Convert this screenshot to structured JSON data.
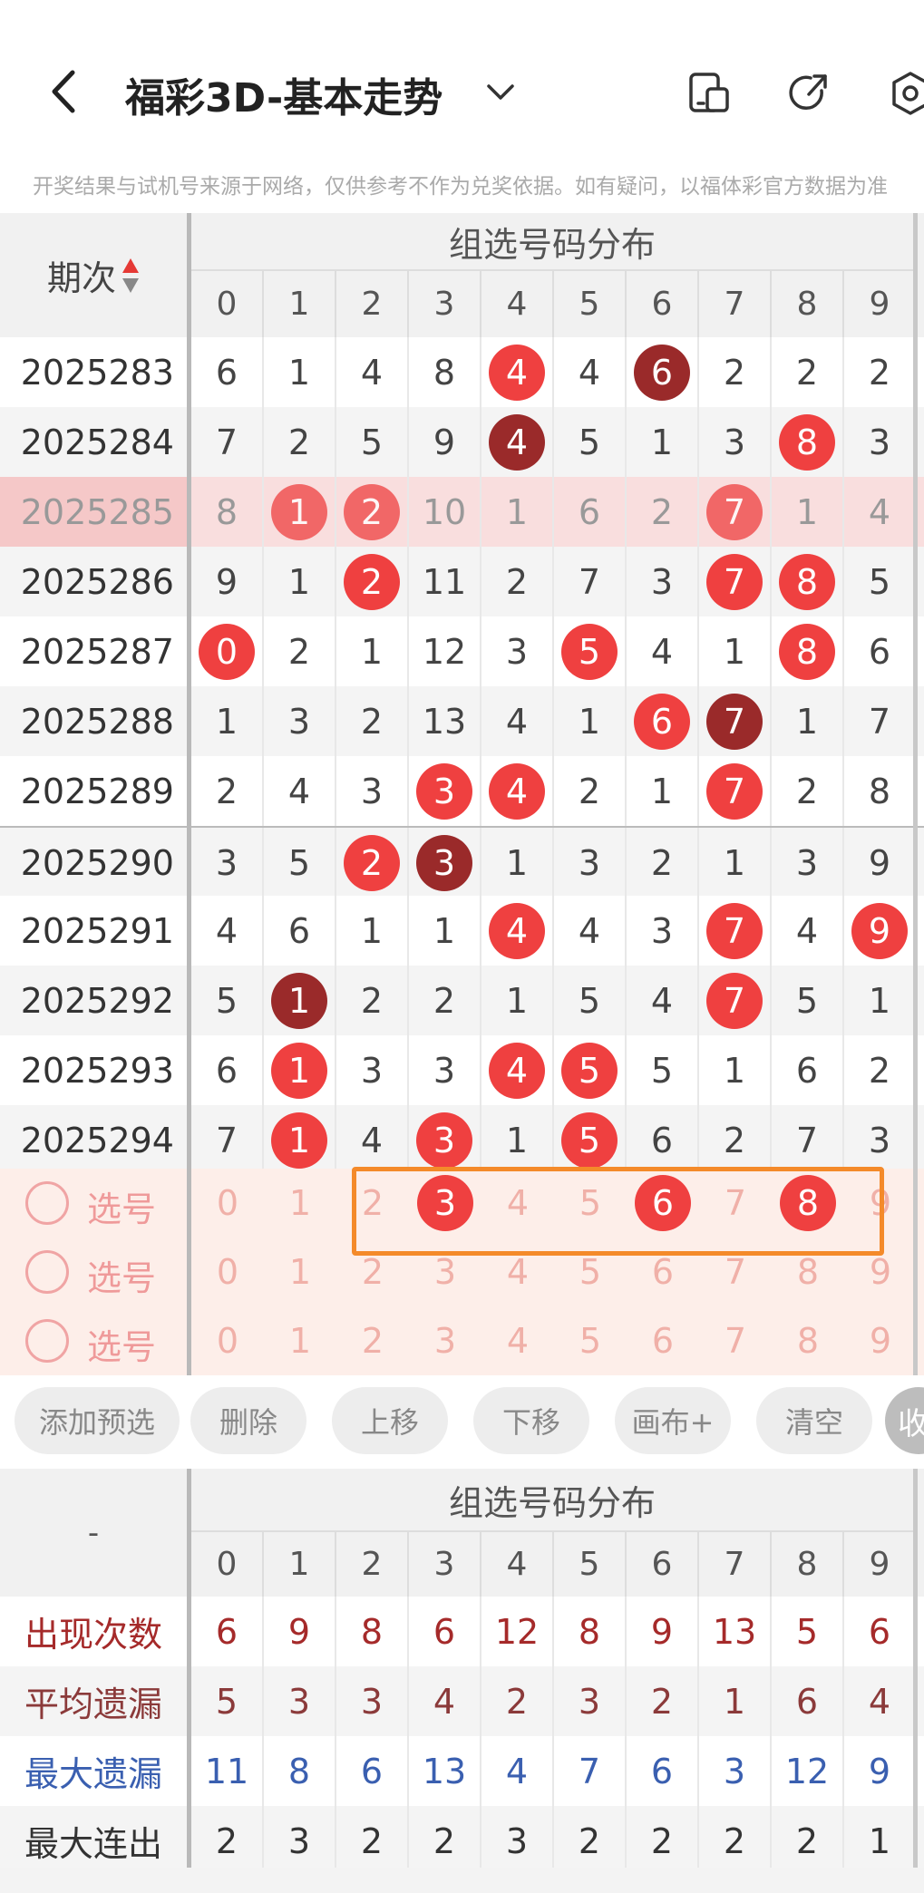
{
  "header": {
    "title": "福彩3D-基本走势"
  },
  "disclaimer": "开奖结果与试机号来源于网络，仅供参考不作为兑奖依据。如有疑问，以福体彩官方数据为准",
  "table": {
    "period_header": "期次",
    "group_header": "组选号码分布",
    "digits": [
      "0",
      "1",
      "2",
      "3",
      "4",
      "5",
      "6",
      "7",
      "8",
      "9"
    ],
    "rows": [
      {
        "period": "2025283",
        "values": [
          "6",
          "1",
          "4",
          "8",
          "4",
          "4",
          "6",
          "2",
          "2",
          "2"
        ],
        "balls": [
          null,
          null,
          null,
          null,
          "red",
          null,
          "dark",
          null,
          null,
          null
        ]
      },
      {
        "period": "2025284",
        "values": [
          "7",
          "2",
          "5",
          "9",
          "4",
          "5",
          "1",
          "3",
          "8",
          "3"
        ],
        "balls": [
          null,
          null,
          null,
          null,
          "dark",
          null,
          null,
          null,
          "red",
          null
        ]
      },
      {
        "period": "2025285",
        "values": [
          "8",
          "1",
          "2",
          "10",
          "1",
          "6",
          "2",
          "7",
          "1",
          "4"
        ],
        "balls": [
          null,
          "red",
          "red",
          null,
          null,
          null,
          null,
          "red",
          null,
          null
        ],
        "highlight": true
      },
      {
        "period": "2025286",
        "values": [
          "9",
          "1",
          "2",
          "11",
          "2",
          "7",
          "3",
          "7",
          "8",
          "5"
        ],
        "balls": [
          null,
          null,
          "red",
          null,
          null,
          null,
          null,
          "red",
          "red",
          null
        ]
      },
      {
        "period": "2025287",
        "values": [
          "0",
          "2",
          "1",
          "12",
          "3",
          "5",
          "4",
          "1",
          "8",
          "6"
        ],
        "balls": [
          "red",
          null,
          null,
          null,
          null,
          "red",
          null,
          null,
          "red",
          null
        ]
      },
      {
        "period": "2025288",
        "values": [
          "1",
          "3",
          "2",
          "13",
          "4",
          "1",
          "6",
          "7",
          "1",
          "7"
        ],
        "balls": [
          null,
          null,
          null,
          null,
          null,
          null,
          "red",
          "dark",
          null,
          null
        ]
      },
      {
        "period": "2025289",
        "values": [
          "2",
          "4",
          "3",
          "3",
          "4",
          "2",
          "1",
          "7",
          "2",
          "8"
        ],
        "balls": [
          null,
          null,
          null,
          "red",
          "red",
          null,
          null,
          "red",
          null,
          null
        ]
      },
      {
        "period": "2025290",
        "values": [
          "3",
          "5",
          "2",
          "3",
          "1",
          "3",
          "2",
          "1",
          "3",
          "9"
        ],
        "balls": [
          null,
          null,
          "red",
          "dark",
          null,
          null,
          null,
          null,
          null,
          null
        ]
      },
      {
        "period": "2025291",
        "values": [
          "4",
          "6",
          "1",
          "1",
          "4",
          "4",
          "3",
          "7",
          "4",
          "9"
        ],
        "balls": [
          null,
          null,
          null,
          null,
          "red",
          null,
          null,
          "red",
          null,
          "red"
        ]
      },
      {
        "period": "2025292",
        "values": [
          "5",
          "1",
          "2",
          "2",
          "1",
          "5",
          "4",
          "7",
          "5",
          "1"
        ],
        "balls": [
          null,
          "dark",
          null,
          null,
          null,
          null,
          null,
          "red",
          null,
          null
        ]
      },
      {
        "period": "2025293",
        "values": [
          "6",
          "1",
          "3",
          "3",
          "4",
          "5",
          "5",
          "1",
          "6",
          "2"
        ],
        "balls": [
          null,
          "red",
          null,
          null,
          "red",
          "red",
          null,
          null,
          null,
          null
        ]
      },
      {
        "period": "2025294",
        "values": [
          "7",
          "1",
          "4",
          "3",
          "1",
          "5",
          "6",
          "2",
          "7",
          "3"
        ],
        "balls": [
          null,
          "red",
          null,
          "red",
          null,
          "red",
          null,
          null,
          null,
          null
        ]
      }
    ],
    "select_rows": [
      {
        "label": "选号",
        "selected": [
          false,
          false,
          false,
          true,
          false,
          false,
          true,
          false,
          true,
          false
        ]
      },
      {
        "label": "选号",
        "selected": [
          false,
          false,
          false,
          false,
          false,
          false,
          false,
          false,
          false,
          false
        ]
      },
      {
        "label": "选号",
        "selected": [
          false,
          false,
          false,
          false,
          false,
          false,
          false,
          false,
          false,
          false
        ]
      }
    ]
  },
  "buttons": [
    "添加预选",
    "删除",
    "上移",
    "下移",
    "画布+",
    "清空",
    "收"
  ],
  "stats": {
    "corner": "-",
    "group_header": "组选号码分布",
    "rows": [
      {
        "label": "出现次数",
        "color": "#a52a2a",
        "values": [
          "6",
          "9",
          "8",
          "6",
          "12",
          "8",
          "9",
          "13",
          "5",
          "6"
        ]
      },
      {
        "label": "平均遗漏",
        "color": "#8b3a3a",
        "values": [
          "5",
          "3",
          "3",
          "4",
          "2",
          "3",
          "2",
          "1",
          "6",
          "4"
        ]
      },
      {
        "label": "最大遗漏",
        "color": "#3a5fb0",
        "values": [
          "11",
          "8",
          "6",
          "13",
          "4",
          "7",
          "6",
          "3",
          "12",
          "9"
        ]
      },
      {
        "label": "最大连出",
        "color": "#333333",
        "values": [
          "2",
          "3",
          "2",
          "2",
          "3",
          "2",
          "2",
          "2",
          "2",
          "1"
        ]
      }
    ]
  },
  "colors": {
    "ball_red": "#ef4040",
    "ball_dark": "#9a2a2a",
    "highlight": "#f9dede",
    "select_bg": "#fdeee9",
    "orange": "#f48a2a"
  }
}
